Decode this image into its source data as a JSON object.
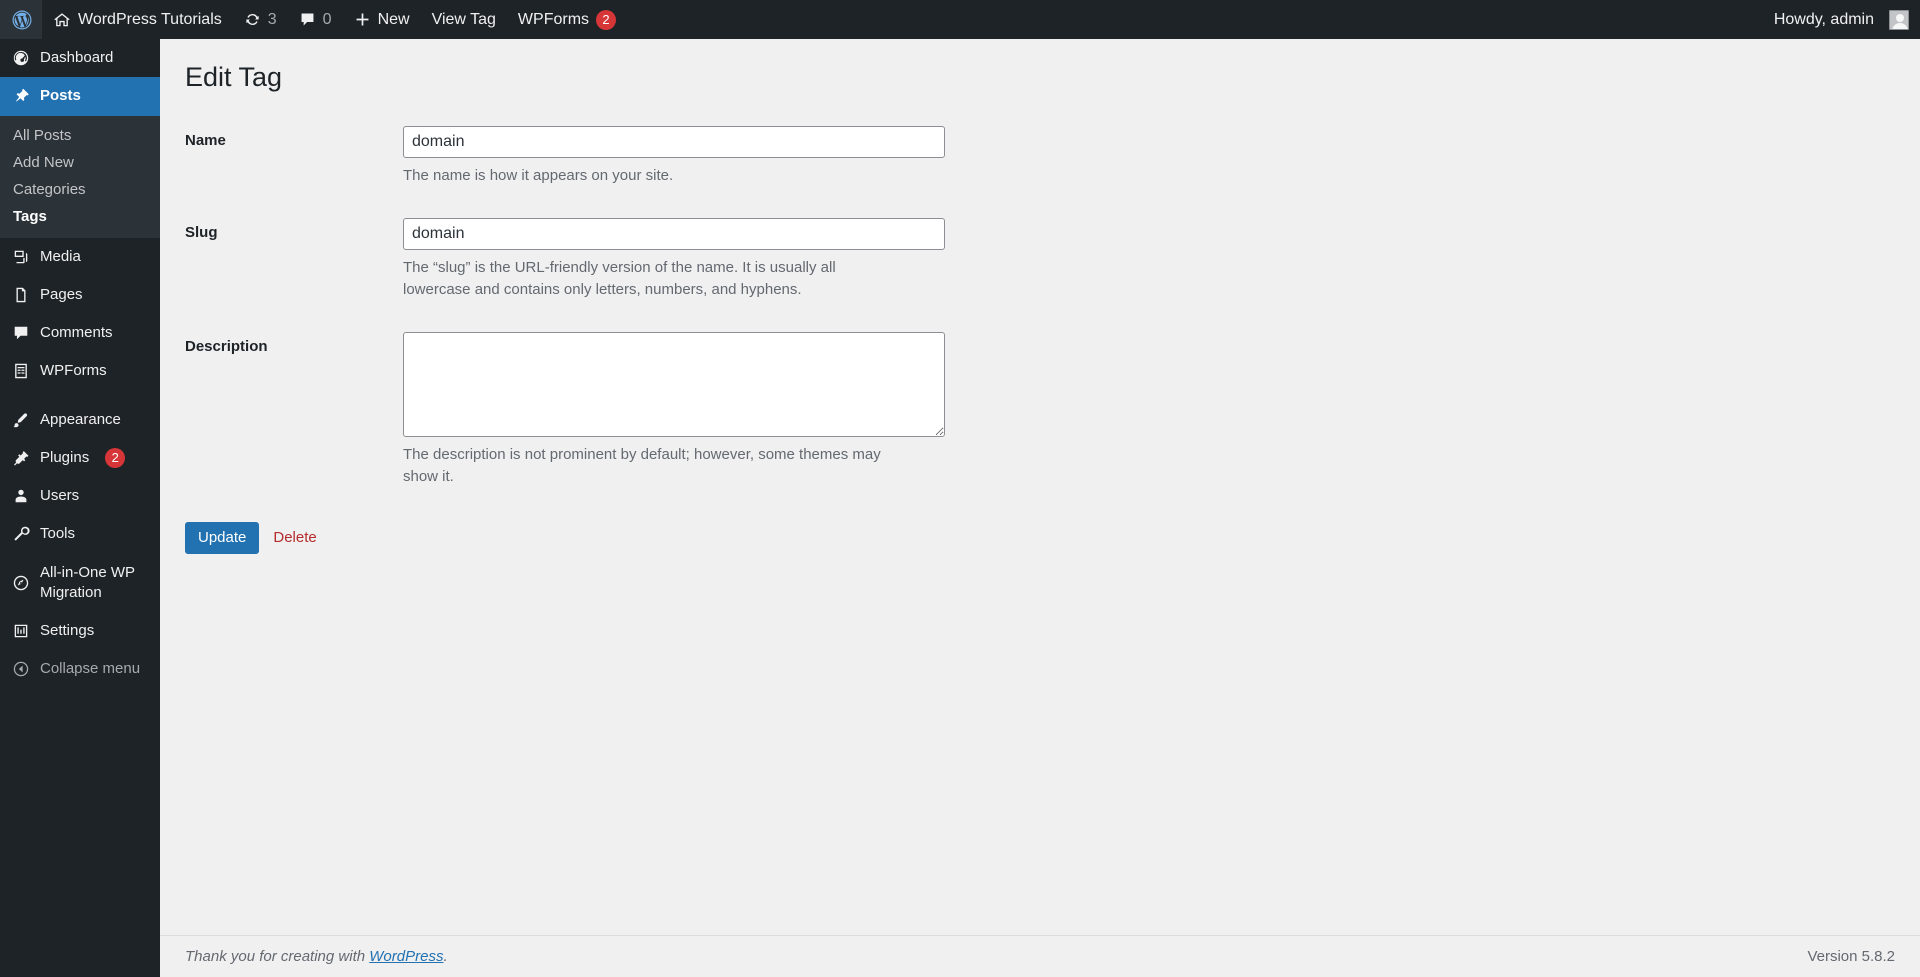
{
  "adminbar": {
    "logo_icon": "wordpress-logo-icon",
    "site_name": "WordPress Tutorials",
    "site_icon": "home-icon",
    "updates": {
      "icon": "updates-icon",
      "count": "3"
    },
    "comments": {
      "icon": "comment-bubble-icon",
      "count": "0"
    },
    "new": {
      "icon": "plus-icon",
      "label": "New"
    },
    "view_tag": "View Tag",
    "wpforms": {
      "label": "WPForms",
      "badge": "2"
    },
    "howdy": "Howdy, admin",
    "avatar": "avatar"
  },
  "sidebar": {
    "items": [
      {
        "label": "Dashboard",
        "icon": "dashboard-icon",
        "current": false
      },
      {
        "label": "Posts",
        "icon": "pin-icon",
        "current": true
      },
      {
        "label": "Media",
        "icon": "media-icon",
        "current": false
      },
      {
        "label": "Pages",
        "icon": "pages-icon",
        "current": false
      },
      {
        "label": "Comments",
        "icon": "comment-bubble-icon",
        "current": false
      },
      {
        "label": "WPForms",
        "icon": "wpforms-icon",
        "current": false
      },
      {
        "label": "Appearance",
        "icon": "brush-icon",
        "current": false
      },
      {
        "label": "Plugins",
        "icon": "plug-icon",
        "current": false,
        "badge": "2"
      },
      {
        "label": "Users",
        "icon": "users-icon",
        "current": false
      },
      {
        "label": "Tools",
        "icon": "wrench-icon",
        "current": false
      },
      {
        "label": "All-in-One WP Migration",
        "icon": "migration-icon",
        "current": false
      },
      {
        "label": "Settings",
        "icon": "settings-icon",
        "current": false
      }
    ],
    "posts_submenu": [
      {
        "label": "All Posts",
        "current": false
      },
      {
        "label": "Add New",
        "current": false
      },
      {
        "label": "Categories",
        "current": false
      },
      {
        "label": "Tags",
        "current": true
      }
    ],
    "collapse": {
      "label": "Collapse menu",
      "icon": "collapse-arrow-icon"
    }
  },
  "main": {
    "title": "Edit Tag",
    "fields": {
      "name": {
        "label": "Name",
        "value": "domain",
        "placeholder": "",
        "description": "The name is how it appears on your site."
      },
      "slug": {
        "label": "Slug",
        "value": "domain",
        "placeholder": "",
        "description": "The “slug” is the URL-friendly version of the name. It is usually all lowercase and contains only letters, numbers, and hyphens."
      },
      "description": {
        "label": "Description",
        "value": "",
        "placeholder": "",
        "description": "The description is not prominent by default; however, some themes may show it."
      }
    },
    "update_button": "Update",
    "delete_link": "Delete"
  },
  "footer": {
    "thanks_prefix": "Thank you for creating with ",
    "wordpress_link": "WordPress",
    "thanks_suffix": ".",
    "version": "Version 5.8.2"
  },
  "colors": {
    "admin_dark": "#1d2327",
    "submenu_dark": "#2c3338",
    "accent_blue": "#2271b1",
    "badge_red": "#d63638",
    "delete_red": "#b32d2e",
    "content_bg": "#f0f0f1"
  }
}
